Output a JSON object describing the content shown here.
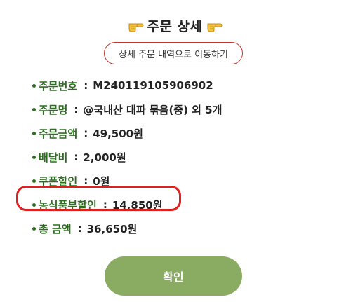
{
  "header": {
    "title": "주문 상세",
    "left_icon": "pointing-hand-icon",
    "right_icon": "pointing-hand-icon"
  },
  "history_button": {
    "label": "상세 주문 내역으로 이동하기"
  },
  "details": [
    {
      "label": "주문번호",
      "value": "M240119105906902"
    },
    {
      "label": "주문명",
      "value": "@국내산 대파 묶음(중) 외 5개"
    },
    {
      "label": "주문금액",
      "value": "49,500원"
    },
    {
      "label": "배달비",
      "value": "2,000원"
    },
    {
      "label": "쿠폰할인",
      "value": "0원"
    },
    {
      "label": "농식품부할인",
      "value": "14,850원"
    },
    {
      "label": "총 금액",
      "value": "36,650원"
    }
  ],
  "colon": ":",
  "highlighted_row": "농식품부할인",
  "confirm_button": {
    "label": "확인"
  },
  "colors": {
    "label_green": "#2e6e21",
    "button_green": "#8aac62",
    "highlight_red": "#e0201e",
    "outline_red": "#c0392b"
  }
}
